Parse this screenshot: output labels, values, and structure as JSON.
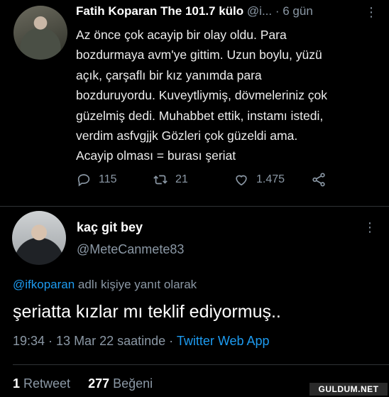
{
  "tweet1": {
    "name": "Fatih Koparan The 101.7 külo",
    "handle": "@i...",
    "time": "· 6 gün",
    "lines": [
      "Az önce çok acayip bir olay oldu. Para",
      "bozdurmaya avm'ye gittim. Uzun boylu, yüzü",
      "açık, çarşaflı bir kız yanımda para",
      "bozduruyordu. Kuveytliymiş, dövmeleriniz çok",
      "güzelmiş dedi. Muhabbet ettik, instamı istedi,",
      "verdim asfvgjjk Gözleri çok güzeldi ama.",
      "Acayip olması = burası şeriat"
    ],
    "replies": "115",
    "retweets": "21",
    "likes": "1.475"
  },
  "tweet2": {
    "name": "kaç git bey",
    "handle": "@MeteCanmete83",
    "reply_mention": "@ifkoparan",
    "reply_suffix": " adlı kişiye yanıt olarak",
    "text": "şeriatta kızlar mı teklif ediyormuş..",
    "timestamp": "19:34 · 13 Mar 22 saatinde · ",
    "app": "Twitter Web App",
    "retweet_count": "1",
    "retweet_label": " Retweet",
    "like_count": "277",
    "like_label": " Beğeni"
  },
  "watermark": "GULDUM.NET",
  "colors": {
    "accent": "#1d9bf0",
    "muted": "#8b98a5",
    "background": "#000000"
  }
}
